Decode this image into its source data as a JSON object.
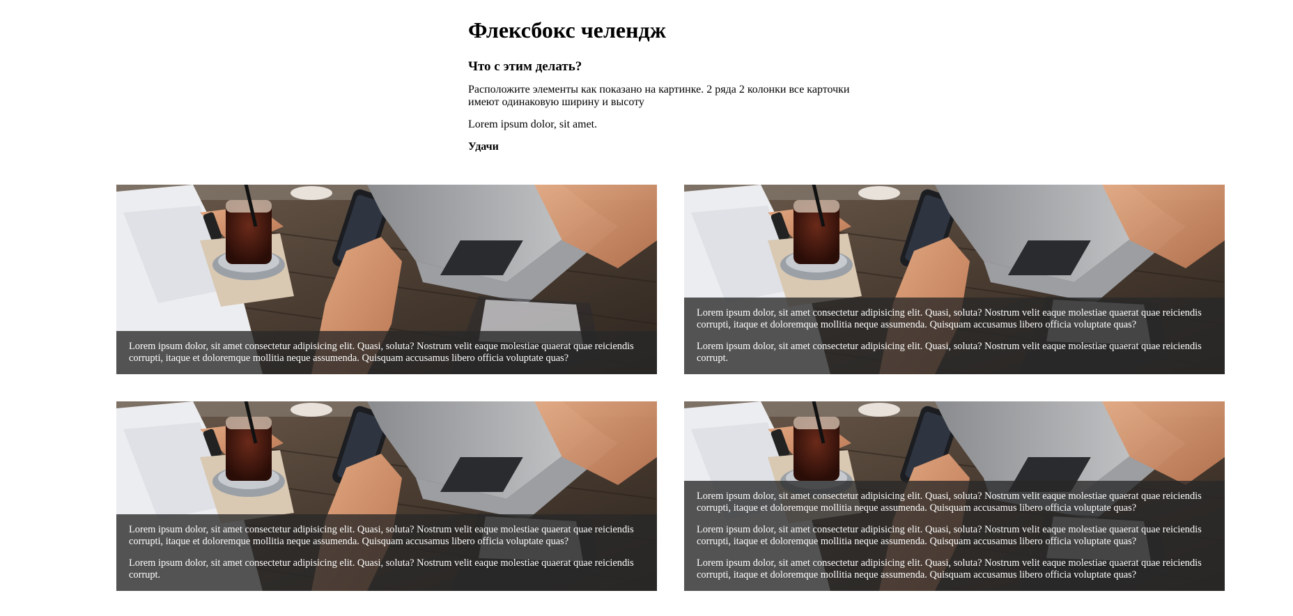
{
  "intro": {
    "title": "Флексбокс челендж",
    "subtitle": "Что с этим делать?",
    "task": "Расположите элементы как показано на картинке. 2 ряда 2 колонки все карточки имеют одинаковую ширину и высоту",
    "lorem": "Lorem ipsum dolor, sit amet.",
    "luck": "Удачи"
  },
  "cards": [
    {
      "image": "cafe-table-phone-laptop-photo",
      "paragraphs": [
        "Lorem ipsum dolor, sit amet consectetur adipisicing elit. Quasi, soluta? Nostrum velit eaque molestiae quaerat quae reiciendis corrupti, itaque et doloremque mollitia neque assumenda. Quisquam accusamus libero officia voluptate quas?"
      ]
    },
    {
      "image": "cafe-table-phone-laptop-photo",
      "paragraphs": [
        "Lorem ipsum dolor, sit amet consectetur adipisicing elit. Quasi, soluta? Nostrum velit eaque molestiae quaerat quae reiciendis corrupti, itaque et doloremque mollitia neque assumenda. Quisquam accusamus libero officia voluptate quas?",
        "Lorem ipsum dolor, sit amet consectetur adipisicing elit. Quasi, soluta? Nostrum velit eaque molestiae quaerat quae reiciendis corrupt."
      ]
    },
    {
      "image": "cafe-table-phone-laptop-photo",
      "paragraphs": [
        "Lorem ipsum dolor, sit amet consectetur adipisicing elit. Quasi, soluta? Nostrum velit eaque molestiae quaerat quae reiciendis corrupti, itaque et doloremque mollitia neque assumenda. Quisquam accusamus libero officia voluptate quas?",
        "Lorem ipsum dolor, sit amet consectetur adipisicing elit. Quasi, soluta? Nostrum velit eaque molestiae quaerat quae reiciendis corrupt."
      ]
    },
    {
      "image": "cafe-table-phone-laptop-photo",
      "paragraphs": [
        "Lorem ipsum dolor, sit amet consectetur adipisicing elit. Quasi, soluta? Nostrum velit eaque molestiae quaerat quae reiciendis corrupti, itaque et doloremque mollitia neque assumenda. Quisquam accusamus libero officia voluptate quas?",
        "Lorem ipsum dolor, sit amet consectetur adipisicing elit. Quasi, soluta? Nostrum velit eaque molestiae quaerat quae reiciendis corrupti, itaque et doloremque mollitia neque assumenda. Quisquam accusamus libero officia voluptate quas?",
        "Lorem ipsum dolor, sit amet consectetur adipisicing elit. Quasi, soluta? Nostrum velit eaque molestiae quaerat quae reiciendis corrupti, itaque et doloremque mollitia neque assumenda. Quisquam accusamus libero officia voluptate quas?"
      ]
    }
  ]
}
